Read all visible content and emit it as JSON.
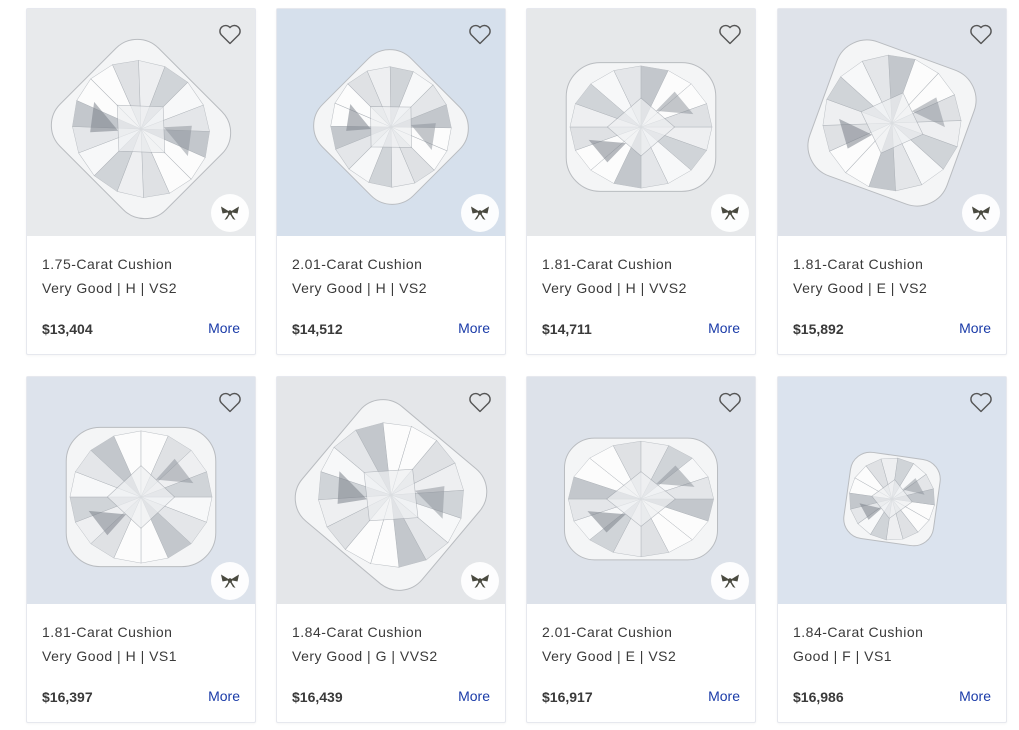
{
  "products": [
    {
      "title": "1.75-Carat Cushion",
      "specs": "Very Good | H | VS2",
      "price": "$13,404",
      "more": "More",
      "bg": "#e8eaec",
      "has_bow": true
    },
    {
      "title": "2.01-Carat Cushion",
      "specs": "Very Good | H | VS2",
      "price": "$14,512",
      "more": "More",
      "bg": "#d6e0ec",
      "has_bow": true
    },
    {
      "title": "1.81-Carat Cushion",
      "specs": "Very Good | H | VVS2",
      "price": "$14,711",
      "more": "More",
      "bg": "#e6e8ea",
      "has_bow": true
    },
    {
      "title": "1.81-Carat Cushion",
      "specs": "Very Good | E | VS2",
      "price": "$15,892",
      "more": "More",
      "bg": "#dfe3ea",
      "has_bow": true
    },
    {
      "title": "1.81-Carat Cushion",
      "specs": "Very Good | H | VS1",
      "price": "$16,397",
      "more": "More",
      "bg": "#dde3ec",
      "has_bow": true
    },
    {
      "title": "1.84-Carat Cushion",
      "specs": "Very Good | G | VVS2",
      "price": "$16,439",
      "more": "More",
      "bg": "#e4e6e9",
      "has_bow": true
    },
    {
      "title": "2.01-Carat Cushion",
      "specs": "Very Good | E | VS2",
      "price": "$16,917",
      "more": "More",
      "bg": "#dde2ea",
      "has_bow": true
    },
    {
      "title": "1.84-Carat Cushion",
      "specs": "Good | F | VS1",
      "price": "$16,986",
      "more": "More",
      "bg": "#dbe3ee",
      "has_bow": false
    }
  ],
  "colors": {
    "link": "#1a3ba8",
    "text": "#3a3a3a",
    "border": "#e6e8ee"
  },
  "icons": {
    "favorite": "heart-icon",
    "gift": "bow-icon"
  }
}
